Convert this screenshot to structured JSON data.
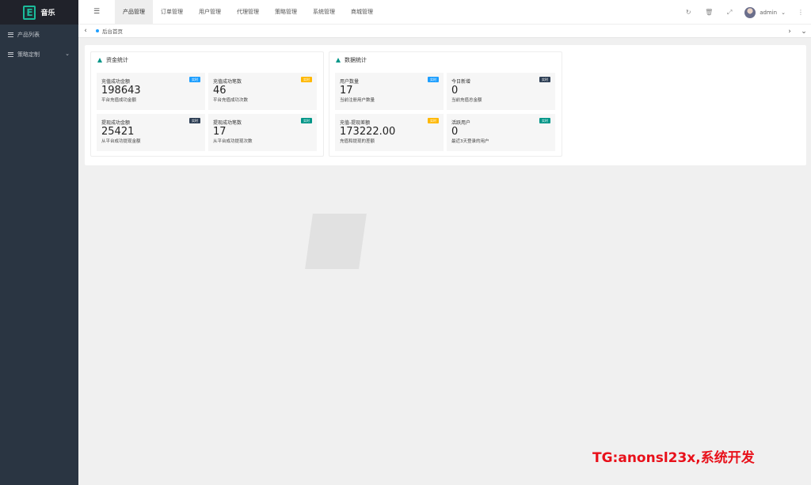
{
  "brand": {
    "logo_letter": "E",
    "name": "音乐"
  },
  "sidebar": {
    "items": [
      {
        "label": "产品列表"
      },
      {
        "label": "策略定制"
      }
    ]
  },
  "header": {
    "tabs": [
      "产品管理",
      "订单管理",
      "用户管理",
      "代理管理",
      "策略管理",
      "系统管理",
      "商城管理"
    ],
    "active_tab": "产品管理",
    "username": "admin"
  },
  "breadcrumb": {
    "current": "后台首页"
  },
  "fund_stats": {
    "title": "资金统计",
    "cards": [
      {
        "label": "充值成功金额",
        "value": "198643",
        "sub": "平台充值成功金额",
        "badge": "实时",
        "badge_color": "#1e9fff"
      },
      {
        "label": "充值成功笔数",
        "value": "46",
        "sub": "平台充值成功次数",
        "badge": "实时",
        "badge_color": "#ffb800"
      },
      {
        "label": "提现成功金额",
        "value": "25421",
        "sub": "从平台成功提现金额",
        "badge": "实时",
        "badge_color": "#2f4056"
      },
      {
        "label": "提现成功笔数",
        "value": "17",
        "sub": "从平台成功提现次数",
        "badge": "实时",
        "badge_color": "#009688"
      }
    ]
  },
  "data_stats": {
    "title": "数据统计",
    "cards": [
      {
        "label": "用户数量",
        "value": "17",
        "sub": "当前注册用户数量",
        "badge": "实时",
        "badge_color": "#1e9fff"
      },
      {
        "label": "今日新增",
        "value": "0",
        "sub": "当前充值总金额",
        "badge": "实时",
        "badge_color": "#2f4056"
      },
      {
        "label": "充值-提现差额",
        "value": "173222.00",
        "sub": "充值和提现的差额",
        "badge": "实时",
        "badge_color": "#ffb800"
      },
      {
        "label": "活跃用户",
        "value": "0",
        "sub": "最近3天登录的用户",
        "badge": "实时",
        "badge_color": "#009688"
      }
    ]
  },
  "overlay_text": "TG:anonsl23x,系统开发"
}
